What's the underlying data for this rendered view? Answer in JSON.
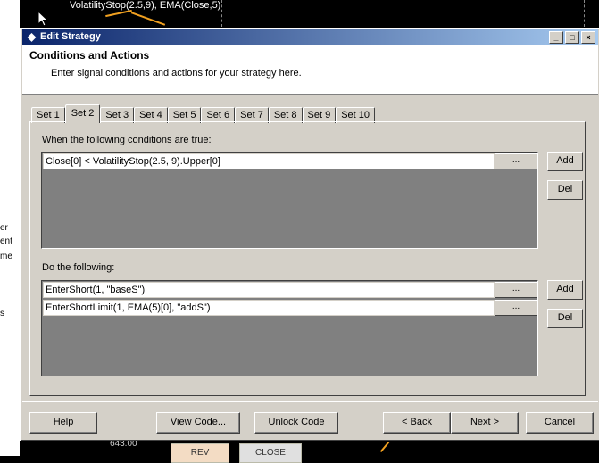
{
  "background": {
    "indicator_label": "VolatilityStop(2.5,9), EMA(Close,5)",
    "left_fragments": [
      "er",
      "ent",
      "me",
      "s"
    ],
    "price_label": "643.00",
    "buttons": [
      "REV",
      "CLOSE"
    ],
    "colors": {
      "line": "#f0a020"
    }
  },
  "dialog": {
    "title": "Edit Strategy",
    "title_icon": "diamond-icon",
    "window_buttons": {
      "minimize": "_",
      "maximize": "□",
      "close": "×"
    },
    "header_title": "Conditions and Actions",
    "header_subtitle": "Enter signal conditions and actions for your strategy here.",
    "tabs": [
      "Set 1",
      "Set 2",
      "Set 3",
      "Set 4",
      "Set 5",
      "Set 6",
      "Set 7",
      "Set 8",
      "Set 9",
      "Set 10"
    ],
    "active_tab": "Set 2",
    "conditions": {
      "label": "When the following conditions are true:",
      "rows": [
        "Close[0] < VolatilityStop(2.5, 9).Upper[0]"
      ],
      "add_label": "Add",
      "del_label": "Del"
    },
    "actions": {
      "label": "Do the following:",
      "rows": [
        "EnterShort(1, \"baseS\")",
        "EnterShortLimit(1, EMA(5)[0], \"addS\")"
      ],
      "add_label": "Add",
      "del_label": "Del"
    },
    "row_button_label": "...",
    "footer": {
      "help": "Help",
      "view_code": "View Code...",
      "unlock_code": "Unlock Code",
      "back": "< Back",
      "next": "Next >",
      "cancel": "Cancel"
    },
    "colors": {
      "titlebar_start": "#0a246a",
      "titlebar_end": "#a6caf0",
      "face": "#d4d0c8",
      "list_bg": "#808080"
    }
  }
}
